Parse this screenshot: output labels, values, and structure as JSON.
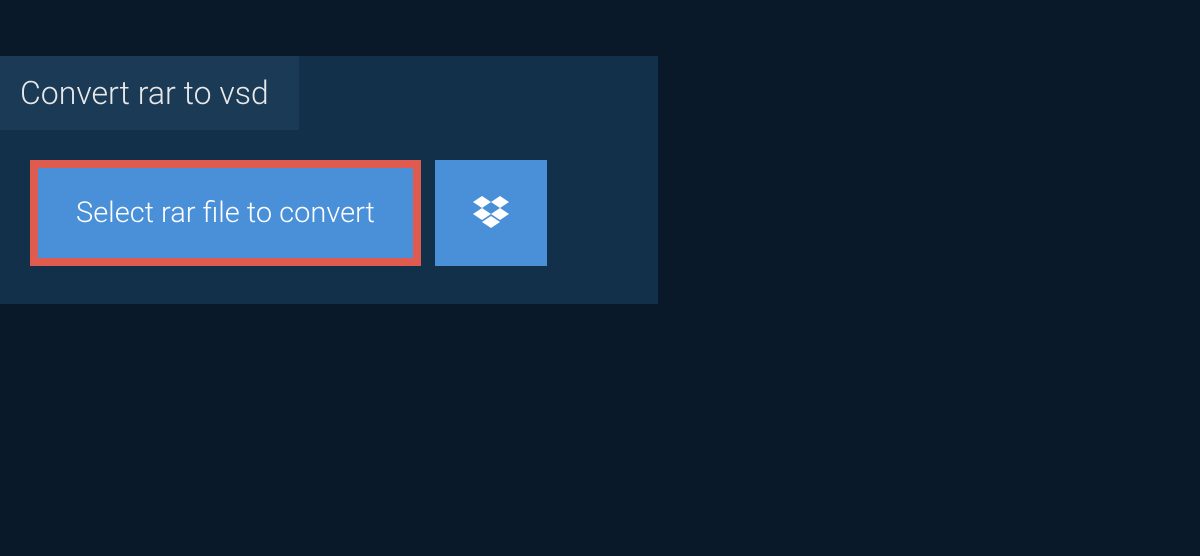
{
  "tab": {
    "label": "Convert rar to vsd"
  },
  "actions": {
    "select_file_label": "Select rar file to convert",
    "dropbox_icon_name": "dropbox"
  },
  "colors": {
    "background": "#0a1929",
    "panel": "#13304b",
    "tab": "#1a3a56",
    "button": "#4a90d9",
    "highlight_border": "#e05b4f",
    "text_light": "#e8e8e8",
    "text_white": "#ffffff"
  }
}
